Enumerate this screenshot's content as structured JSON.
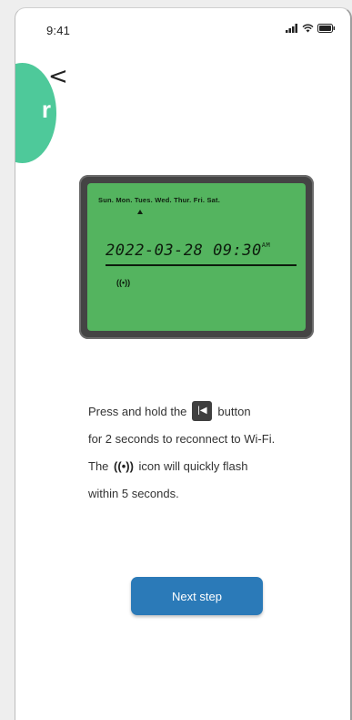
{
  "status_bar": {
    "time": "9:41",
    "icons": [
      "signal-icon",
      "wifi-icon",
      "battery-icon"
    ]
  },
  "nav": {
    "back_icon": "chevron-left-icon",
    "back_glyph": "<"
  },
  "badge": {
    "glyph": "r",
    "color": "#4ec99a"
  },
  "device_display": {
    "days": "Sun. Mon. Tues. Wed. Thur. Fri. Sat.",
    "datetime": "2022-03-28 09:30",
    "ampm": "AM",
    "wifi_glyph": "((•))",
    "screen_color": "#54b45f"
  },
  "instructions": {
    "line1_prefix": "Press and hold the",
    "button_glyph": "|◀",
    "line1_suffix": "button",
    "line2": "for 2 seconds to reconnect to Wi-Fi.",
    "line3_prefix": "The",
    "wifi_glyph": "((•))",
    "line3_suffix": "icon will quickly flash",
    "line4": "within 5 seconds."
  },
  "next_button": {
    "label": "Next step",
    "color": "#2b7ab8"
  }
}
